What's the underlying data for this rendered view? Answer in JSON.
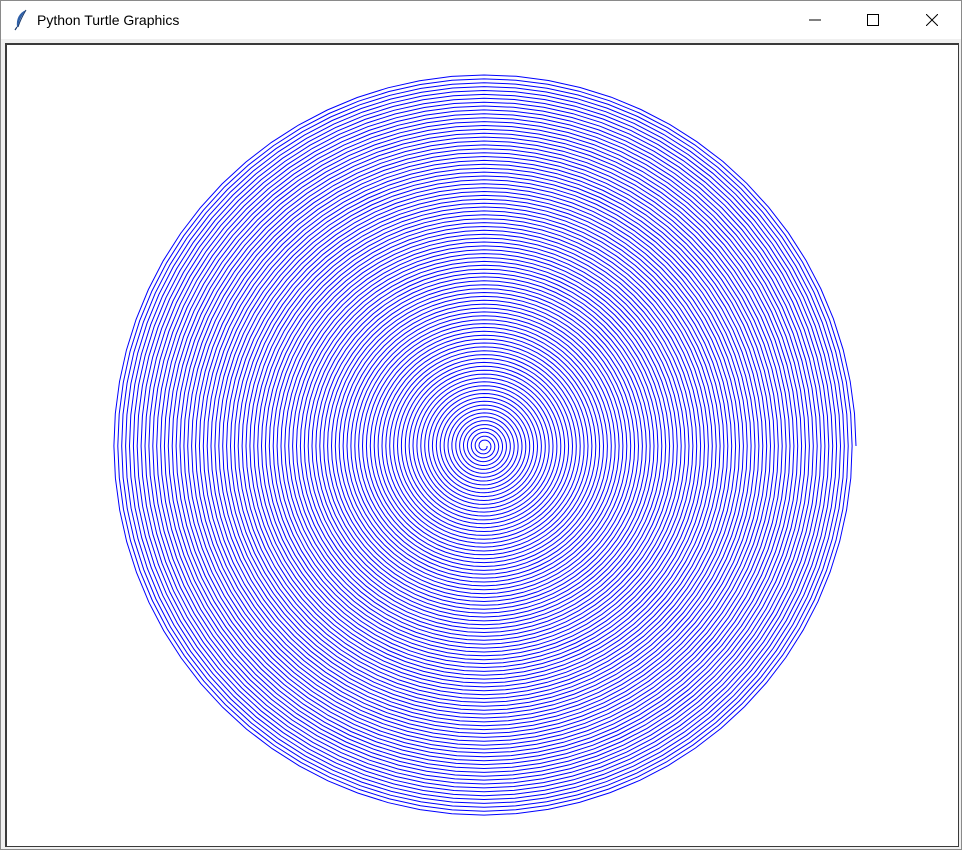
{
  "window": {
    "title": "Python Turtle Graphics",
    "app_icon": "feather-icon",
    "controls": [
      "minimize-icon",
      "maximize-icon",
      "close-icon"
    ]
  },
  "drawing": {
    "shape": "spiral",
    "pen_color": "#0000ff",
    "background": "#ffffff"
  }
}
